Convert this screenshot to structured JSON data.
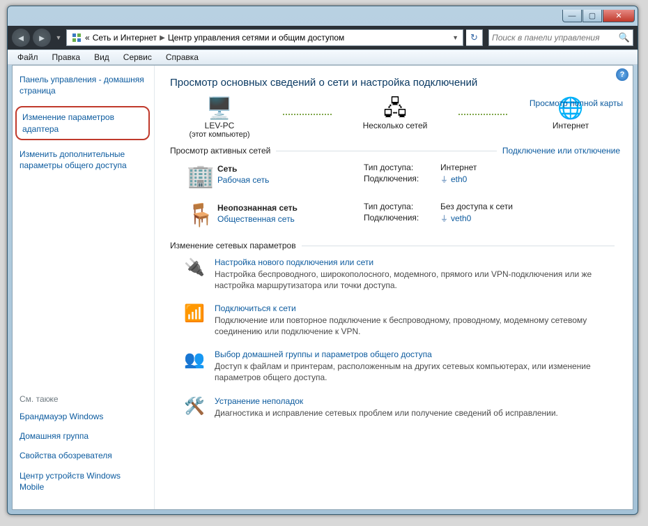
{
  "title_buttons": {
    "min": "—",
    "max": "▢",
    "close": "✕"
  },
  "breadcrumb": {
    "prefix": "«",
    "seg1": "Сеть и Интернет",
    "seg2": "Центр управления сетями и общим доступом"
  },
  "search": {
    "placeholder": "Поиск в панели управления"
  },
  "menu": {
    "file": "Файл",
    "edit": "Правка",
    "view": "Вид",
    "service": "Сервис",
    "help": "Справка"
  },
  "sidebar": {
    "home": "Панель управления - домашняя страница",
    "adapter": "Изменение параметров адаптера",
    "sharing": "Изменить дополнительные параметры общего доступа",
    "see_also": "См. также",
    "links": {
      "firewall": "Брандмауэр Windows",
      "homegroup": "Домашняя группа",
      "browser": "Свойства обозревателя",
      "wmobile": "Центр устройств Windows Mobile"
    }
  },
  "main": {
    "heading": "Просмотр основных сведений о сети и настройка подключений",
    "fullmap": "Просмотр полной карты",
    "nodes": {
      "pc": "LEV-PC",
      "pc_sub": "(этот компьютер)",
      "multi": "Несколько сетей",
      "internet": "Интернет"
    },
    "active_nets": "Просмотр активных сетей",
    "connect_toggle": "Подключение или отключение",
    "net1": {
      "name": "Сеть",
      "type": "Рабочая сеть",
      "access_k": "Тип доступа:",
      "access_v": "Интернет",
      "conn_k": "Подключения:",
      "conn_v": "eth0"
    },
    "net2": {
      "name": "Неопознанная сеть",
      "type": "Общественная сеть",
      "access_k": "Тип доступа:",
      "access_v": "Без доступа к сети",
      "conn_k": "Подключения:",
      "conn_v": "veth0"
    },
    "change_params": "Изменение сетевых параметров",
    "opts": {
      "o1": {
        "t": "Настройка нового подключения или сети",
        "d": "Настройка беспроводного, широкополосного, модемного, прямого или VPN-подключения или же настройка маршрутизатора или точки доступа."
      },
      "o2": {
        "t": "Подключиться к сети",
        "d": "Подключение или повторное подключение к беспроводному, проводному, модемному сетевому соединению или подключение к VPN."
      },
      "o3": {
        "t": "Выбор домашней группы и параметров общего доступа",
        "d": "Доступ к файлам и принтерам, расположенным на других сетевых компьютерах, или изменение параметров общего доступа."
      },
      "o4": {
        "t": "Устранение неполадок",
        "d": "Диагностика и исправление сетевых проблем или получение сведений об исправлении."
      }
    }
  }
}
